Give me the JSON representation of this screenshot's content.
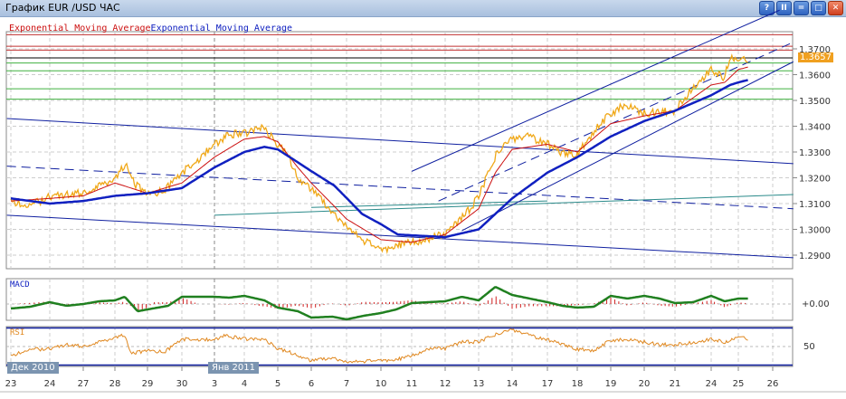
{
  "window": {
    "title": "График EUR /USD  ЧАС",
    "buttons": [
      "?",
      "II",
      "=",
      "□",
      "✕"
    ]
  },
  "legend": {
    "ema_red": "Exponential  Moving  Average",
    "ema_blue": "Exponential  Moving  Average"
  },
  "current_price": "1.3657",
  "colors": {
    "price": "#f0a818",
    "ema_fast": "#cc1010",
    "ema_slow": "#1020c0",
    "macd": "#208020",
    "rsi": "#e08820"
  },
  "panels": {
    "macd": "MACD",
    "rsi": "RSI",
    "macd_tick": "+0.00",
    "rsi_tick": "50"
  },
  "months": [
    "Дек 2010",
    "Янв 2011"
  ],
  "chart_data": {
    "type": "line",
    "title": "График EUR /USD  ЧАС",
    "x_ticks": [
      "23",
      "24",
      "27",
      "28",
      "29",
      "30",
      "3",
      "4",
      "5",
      "6",
      "7",
      "10",
      "11",
      "12",
      "13",
      "14",
      "17",
      "18",
      "19",
      "20",
      "21",
      "24",
      "25",
      "26"
    ],
    "y_ticks": [
      "1.3700",
      "1.3600",
      "1.3500",
      "1.3400",
      "1.3300",
      "1.3200",
      "1.3100",
      "1.3000",
      "1.2900"
    ],
    "ylim": [
      1.286,
      1.376
    ],
    "price": [
      [
        0,
        1.311
      ],
      [
        0.5,
        1.309
      ],
      [
        1,
        1.313
      ],
      [
        2,
        1.314
      ],
      [
        2.5,
        1.317
      ],
      [
        3,
        1.32
      ],
      [
        3.35,
        1.326
      ],
      [
        3.6,
        1.318
      ],
      [
        4,
        1.313
      ],
      [
        4.5,
        1.315
      ],
      [
        5,
        1.322
      ],
      [
        5.5,
        1.327
      ],
      [
        6,
        1.333
      ],
      [
        6.5,
        1.337
      ],
      [
        7,
        1.337
      ],
      [
        7.55,
        1.34
      ],
      [
        8,
        1.333
      ],
      [
        8.3,
        1.329
      ],
      [
        8.6,
        1.32
      ],
      [
        9,
        1.316
      ],
      [
        9.65,
        1.306
      ],
      [
        10,
        1.301
      ],
      [
        10.45,
        1.296
      ],
      [
        11,
        1.292
      ],
      [
        11.55,
        1.294
      ],
      [
        12,
        1.295
      ],
      [
        13,
        1.298
      ],
      [
        13.75,
        1.308
      ],
      [
        14,
        1.313
      ],
      [
        14.3,
        1.322
      ],
      [
        14.55,
        1.33
      ],
      [
        15,
        1.335
      ],
      [
        15.5,
        1.336
      ],
      [
        16,
        1.333
      ],
      [
        16.45,
        1.33
      ],
      [
        17,
        1.329
      ],
      [
        17.6,
        1.34
      ],
      [
        18,
        1.345
      ],
      [
        18.4,
        1.348
      ],
      [
        19,
        1.345
      ],
      [
        20,
        1.346
      ],
      [
        20.5,
        1.355
      ],
      [
        21,
        1.362
      ],
      [
        21.45,
        1.359
      ],
      [
        21.7,
        1.367
      ],
      [
        22,
        1.365
      ],
      [
        22.3,
        1.366
      ]
    ],
    "ema_fast": [
      [
        0,
        1.311
      ],
      [
        1,
        1.312
      ],
      [
        2,
        1.313
      ],
      [
        3,
        1.318
      ],
      [
        4,
        1.314
      ],
      [
        5,
        1.318
      ],
      [
        6,
        1.328
      ],
      [
        7,
        1.335
      ],
      [
        7.6,
        1.336
      ],
      [
        8,
        1.334
      ],
      [
        8.6,
        1.324
      ],
      [
        9,
        1.318
      ],
      [
        9.65,
        1.309
      ],
      [
        10,
        1.304
      ],
      [
        11,
        1.296
      ],
      [
        12,
        1.295
      ],
      [
        13,
        1.298
      ],
      [
        14,
        1.308
      ],
      [
        14.5,
        1.322
      ],
      [
        15,
        1.331
      ],
      [
        16,
        1.333
      ],
      [
        17,
        1.33
      ],
      [
        18,
        1.341
      ],
      [
        19,
        1.344
      ],
      [
        20,
        1.346
      ],
      [
        21,
        1.356
      ],
      [
        21.5,
        1.357
      ],
      [
        22,
        1.362
      ],
      [
        22.3,
        1.363
      ]
    ],
    "ema_slow": [
      [
        0,
        1.312
      ],
      [
        1,
        1.31
      ],
      [
        2,
        1.311
      ],
      [
        3,
        1.313
      ],
      [
        4,
        1.314
      ],
      [
        5,
        1.316
      ],
      [
        6,
        1.324
      ],
      [
        7,
        1.33
      ],
      [
        7.6,
        1.332
      ],
      [
        8,
        1.331
      ],
      [
        8.6,
        1.326
      ],
      [
        9.65,
        1.317
      ],
      [
        10.45,
        1.306
      ],
      [
        11.55,
        1.298
      ],
      [
        13,
        1.297
      ],
      [
        14,
        1.3
      ],
      [
        15,
        1.312
      ],
      [
        16,
        1.322
      ],
      [
        17,
        1.328
      ],
      [
        18,
        1.336
      ],
      [
        19,
        1.342
      ],
      [
        20,
        1.346
      ],
      [
        21,
        1.352
      ],
      [
        21.7,
        1.356
      ],
      [
        22.3,
        1.358
      ]
    ],
    "levels": {
      "red": [
        1.3755,
        1.371,
        1.3695
      ],
      "black": [
        1.3665
      ],
      "green": [
        1.3645,
        1.3615,
        1.3545,
        1.3505
      ]
    },
    "trend_lines": [
      {
        "style": "solid",
        "color": "#1020a0",
        "points": [
          [
            -0.1,
            1.343
          ],
          [
            23.6,
            1.3255
          ]
        ]
      },
      {
        "style": "dashed",
        "color": "#1020a0",
        "points": [
          [
            -0.1,
            1.3245
          ],
          [
            23.6,
            1.308
          ]
        ]
      },
      {
        "style": "solid",
        "color": "#1020a0",
        "points": [
          [
            -0.1,
            1.3055
          ],
          [
            23.6,
            1.289
          ]
        ]
      },
      {
        "style": "solid",
        "color": "#2a8a8a",
        "points": [
          [
            6,
            1.3055
          ],
          [
            23.6,
            1.3135
          ]
        ]
      },
      {
        "style": "solid",
        "color": "#2a8a8a",
        "points": [
          [
            9,
            1.3085
          ],
          [
            16,
            1.311
          ]
        ]
      },
      {
        "style": "solid",
        "color": "#1020a0",
        "points": [
          [
            12,
            1.3225
          ],
          [
            23.2,
            1.385
          ]
        ]
      },
      {
        "style": "dashed",
        "color": "#1020a0",
        "points": [
          [
            12.8,
            1.311
          ],
          [
            23.5,
            1.372
          ]
        ]
      },
      {
        "style": "solid",
        "color": "#1020a0",
        "points": [
          [
            13.5,
            1.2995
          ],
          [
            23.6,
            1.365
          ]
        ]
      }
    ],
    "macd": [
      [
        0,
        -0.5
      ],
      [
        0.5,
        -0.3
      ],
      [
        1,
        0.2
      ],
      [
        1.5,
        -0.2
      ],
      [
        2,
        0.0
      ],
      [
        2.5,
        0.3
      ],
      [
        3,
        0.4
      ],
      [
        3.3,
        0.8
      ],
      [
        3.7,
        -0.8
      ],
      [
        4,
        -0.6
      ],
      [
        4.6,
        -0.2
      ],
      [
        5,
        0.8
      ],
      [
        6,
        0.8
      ],
      [
        6.5,
        0.7
      ],
      [
        7,
        0.9
      ],
      [
        7.6,
        0.4
      ],
      [
        8,
        -0.4
      ],
      [
        8.6,
        -0.8
      ],
      [
        9,
        -1.5
      ],
      [
        9.6,
        -1.4
      ],
      [
        10,
        -1.7
      ],
      [
        10.5,
        -1.3
      ],
      [
        11,
        -1.0
      ],
      [
        11.5,
        -0.6
      ],
      [
        12,
        0.1
      ],
      [
        13,
        0.3
      ],
      [
        13.5,
        0.8
      ],
      [
        14,
        0.4
      ],
      [
        14.5,
        1.9
      ],
      [
        15,
        1.0
      ],
      [
        16,
        0.2
      ],
      [
        16.5,
        -0.2
      ],
      [
        17,
        -0.4
      ],
      [
        17.5,
        -0.3
      ],
      [
        18,
        0.9
      ],
      [
        18.5,
        0.6
      ],
      [
        19,
        0.9
      ],
      [
        19.5,
        0.6
      ],
      [
        20,
        0.1
      ],
      [
        20.5,
        0.2
      ],
      [
        21,
        0.9
      ],
      [
        21.5,
        0.3
      ],
      [
        22,
        0.6
      ],
      [
        22.3,
        0.6
      ]
    ],
    "rsi": [
      [
        0,
        40
      ],
      [
        0.4,
        46
      ],
      [
        1,
        48
      ],
      [
        1.5,
        52
      ],
      [
        2,
        50
      ],
      [
        2.5,
        55
      ],
      [
        3,
        60
      ],
      [
        3.3,
        63
      ],
      [
        3.5,
        43
      ],
      [
        4,
        45
      ],
      [
        4.5,
        44
      ],
      [
        5,
        58
      ],
      [
        6,
        57
      ],
      [
        6.3,
        62
      ],
      [
        7,
        58
      ],
      [
        7.6,
        58
      ],
      [
        8,
        48
      ],
      [
        8.5,
        42
      ],
      [
        9,
        35
      ],
      [
        9.6,
        38
      ],
      [
        10,
        33
      ],
      [
        10.5,
        34
      ],
      [
        11,
        35
      ],
      [
        11.5,
        36
      ],
      [
        12,
        40
      ],
      [
        12.5,
        48
      ],
      [
        13,
        48
      ],
      [
        13.5,
        55
      ],
      [
        14,
        55
      ],
      [
        14.5,
        63
      ],
      [
        15,
        68
      ],
      [
        15.5,
        62
      ],
      [
        16,
        57
      ],
      [
        16.5,
        53
      ],
      [
        17,
        47
      ],
      [
        17.5,
        46
      ],
      [
        18,
        57
      ],
      [
        18.5,
        57
      ],
      [
        19,
        55
      ],
      [
        19.5,
        52
      ],
      [
        20,
        52
      ],
      [
        20.5,
        54
      ],
      [
        21,
        58
      ],
      [
        21.5,
        55
      ],
      [
        22,
        60
      ],
      [
        22.3,
        58
      ]
    ],
    "rsi_levels": [
      70,
      30
    ]
  }
}
